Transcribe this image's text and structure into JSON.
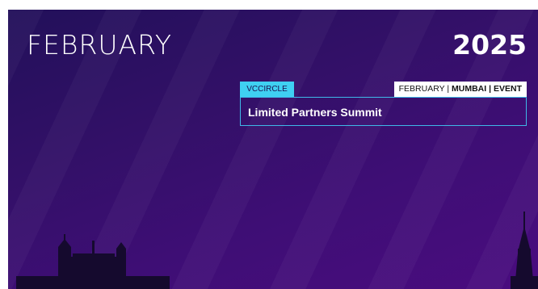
{
  "banner": {
    "month": "FEBRUARY",
    "year": "2025"
  },
  "event": {
    "tag": "VCCIRCLE",
    "meta_month": "FEBRUARY",
    "meta_sep1": "|",
    "meta_city": "MUMBAI",
    "meta_sep2": "|",
    "meta_type": "EVENT",
    "title": "Limited Partners Summit"
  },
  "colors": {
    "background_dark": "#22105a",
    "background_light": "#4a0c7f",
    "accent": "#3fd0f2"
  },
  "icons": {
    "left_silhouette": "building-silhouette-icon",
    "right_silhouette": "tower-silhouette-icon"
  }
}
